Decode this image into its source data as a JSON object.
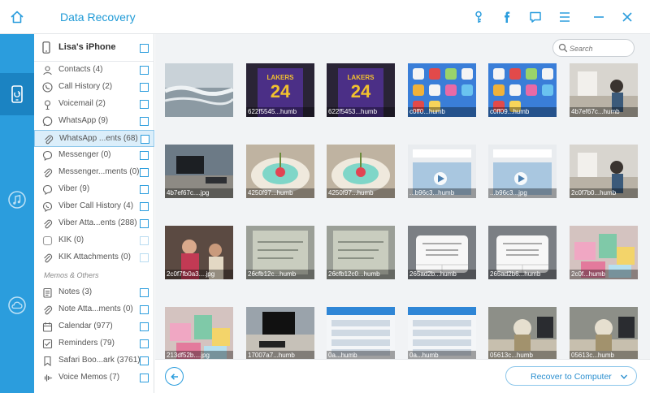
{
  "app": {
    "title": "Data Recovery"
  },
  "device": {
    "name": "Lisa's iPhone"
  },
  "categories_top": [
    {
      "label": "Contacts (4)",
      "icon": "contact-icon"
    },
    {
      "label": "Call History (2)",
      "icon": "phone-icon"
    },
    {
      "label": "Voicemail (2)",
      "icon": "voicemail-icon"
    },
    {
      "label": "WhatsApp (9)",
      "icon": "whatsapp-icon"
    },
    {
      "label": "WhatsApp ...ents (68)",
      "icon": "attachment-icon",
      "selected": true
    },
    {
      "label": "Messenger (0)",
      "icon": "messenger-icon"
    },
    {
      "label": "Messenger...ments (0)",
      "icon": "attachment-icon"
    },
    {
      "label": "Viber (9)",
      "icon": "viber-icon"
    },
    {
      "label": "Viber Call History (4)",
      "icon": "viber-call-icon"
    },
    {
      "label": "Viber Atta...ents (288)",
      "icon": "attachment-icon"
    },
    {
      "label": "KIK (0)",
      "icon": "kik-icon",
      "disabled": true
    },
    {
      "label": "KIK Attachments (0)",
      "icon": "attachment-icon",
      "disabled": true
    }
  ],
  "section_memos": "Memos & Others",
  "categories_memos": [
    {
      "label": "Notes (3)",
      "icon": "notes-icon"
    },
    {
      "label": "Note Atta...ments (0)",
      "icon": "attachment-icon"
    },
    {
      "label": "Calendar (977)",
      "icon": "calendar-icon"
    },
    {
      "label": "Reminders (79)",
      "icon": "reminders-icon"
    },
    {
      "label": "Safari Boo...ark (3761)",
      "icon": "bookmark-icon"
    },
    {
      "label": "Voice Memos (7)",
      "icon": "voice-memo-icon"
    }
  ],
  "search": {
    "placeholder": "Search"
  },
  "thumbnails": [
    {
      "caption": "",
      "kind": "sea"
    },
    {
      "caption": "622f5545...humb",
      "kind": "jersey"
    },
    {
      "caption": "622f5453...humb",
      "kind": "jersey"
    },
    {
      "caption": "c0ff0...humb",
      "kind": "homescreen"
    },
    {
      "caption": "c0ff09...humb",
      "kind": "homescreen"
    },
    {
      "caption": "4b7ef67c...humb",
      "kind": "office"
    },
    {
      "caption": "4b7ef67c....jpg",
      "kind": "desk"
    },
    {
      "caption": "4250f97...humb",
      "kind": "cake"
    },
    {
      "caption": "4250f97...humb",
      "kind": "cake"
    },
    {
      "caption": "...b96c3...humb",
      "kind": "video"
    },
    {
      "caption": "...b96c3...jpg",
      "kind": "video"
    },
    {
      "caption": "2c0f7b0...humb",
      "kind": "office"
    },
    {
      "caption": "2c0f7fb0a3....jpg",
      "kind": "party"
    },
    {
      "caption": "26cfb12c...humb",
      "kind": "screen"
    },
    {
      "caption": "26cfb12c0...humb",
      "kind": "screen"
    },
    {
      "caption": "265ad2b...humb",
      "kind": "dialog"
    },
    {
      "caption": "265ad2b6...humb",
      "kind": "dialog"
    },
    {
      "caption": "2c0f...humb",
      "kind": "gifts"
    },
    {
      "caption": "213df52b....jpg",
      "kind": "gifts"
    },
    {
      "caption": "17007a7...humb",
      "kind": "desk2"
    },
    {
      "caption": "0a...humb",
      "kind": "chatlist"
    },
    {
      "caption": "0a...humb",
      "kind": "chatlist"
    },
    {
      "caption": "05613c...humb",
      "kind": "figurine"
    },
    {
      "caption": "05613c...humb",
      "kind": "figurine"
    }
  ],
  "footer": {
    "recover_label": "Recover to Computer"
  },
  "colors": {
    "accent": "#2b9ddd",
    "rail": "#2b9ddd",
    "rail_active": "#1b83c2"
  }
}
